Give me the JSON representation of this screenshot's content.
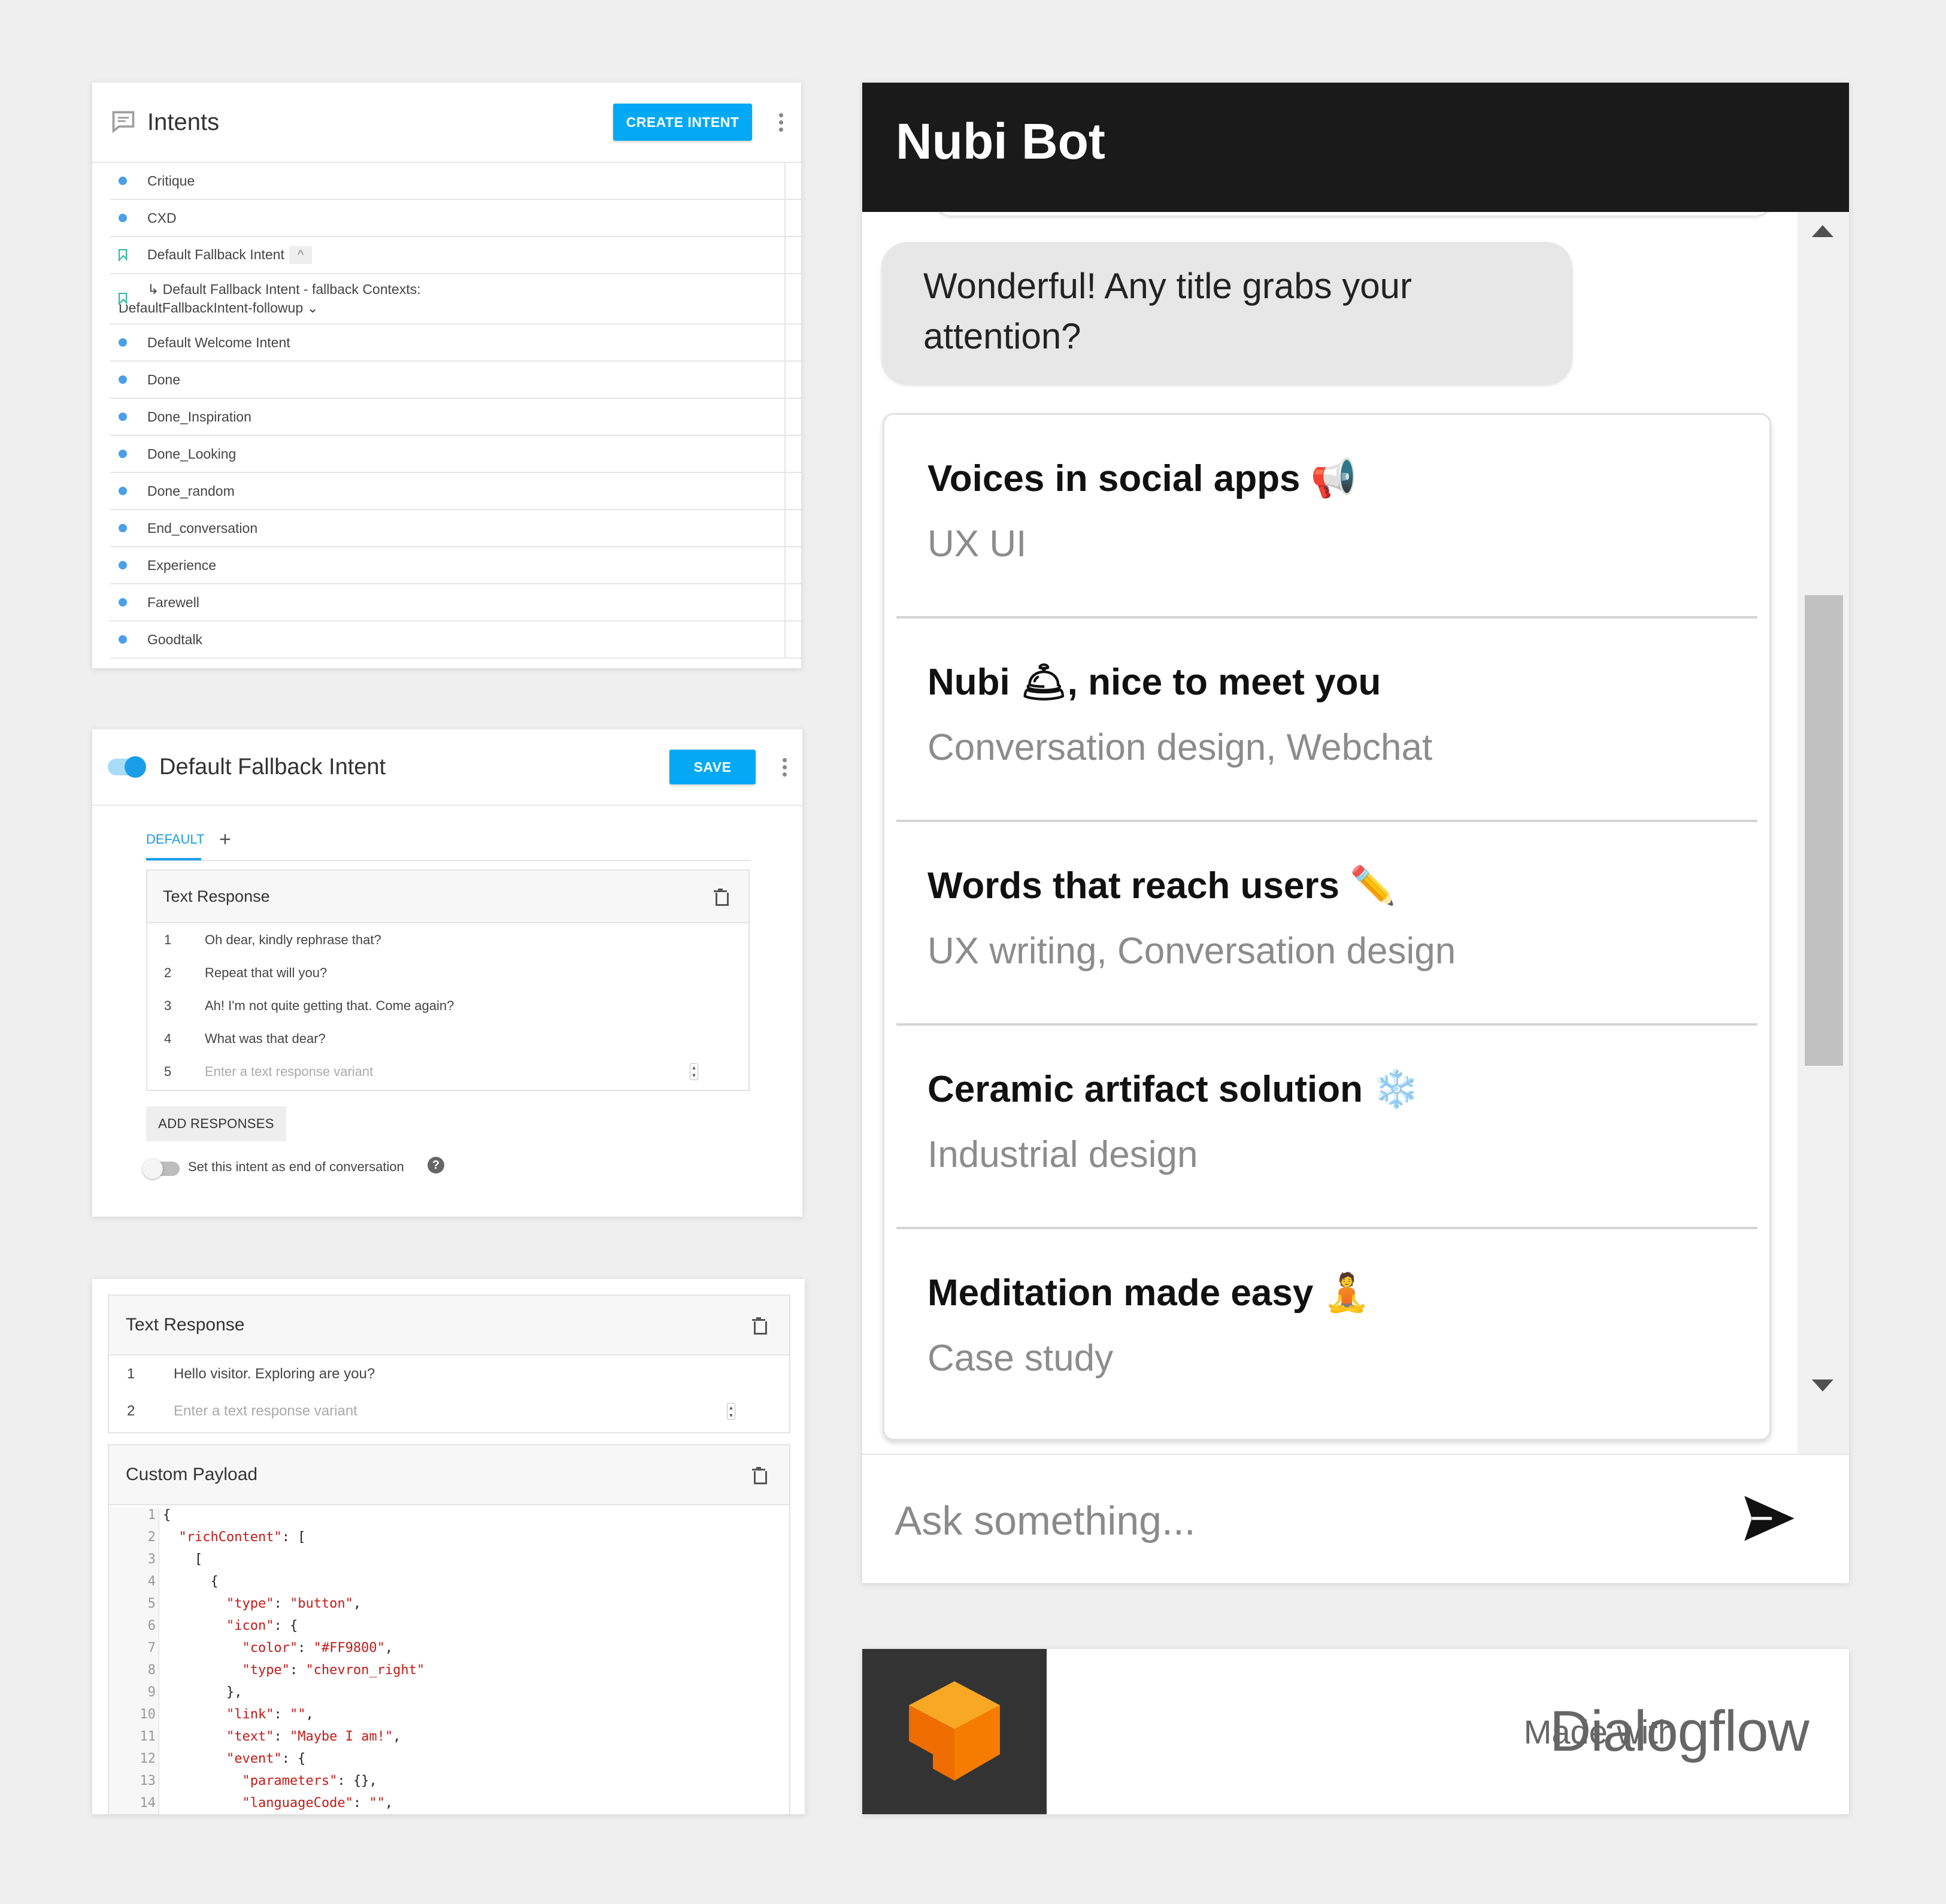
{
  "intents_panel": {
    "title": "Intents",
    "create_button": "CREATE INTENT",
    "items": [
      {
        "label": "Critique",
        "type": "dot"
      },
      {
        "label": "CXD",
        "type": "dot"
      },
      {
        "label": "Default Fallback Intent",
        "type": "bookmark",
        "chip": "^"
      },
      {
        "label": "↳  Default Fallback Intent - fallback     Contexts:",
        "label2": "DefaultFallbackIntent-followup  ⌄",
        "type": "bookmark"
      },
      {
        "label": "Default Welcome Intent",
        "type": "dot"
      },
      {
        "label": "Done",
        "type": "dot"
      },
      {
        "label": "Done_Inspiration",
        "type": "dot"
      },
      {
        "label": "Done_Looking",
        "type": "dot"
      },
      {
        "label": "Done_random",
        "type": "dot"
      },
      {
        "label": "End_conversation",
        "type": "dot"
      },
      {
        "label": "Experience",
        "type": "dot"
      },
      {
        "label": "Farewell",
        "type": "dot"
      },
      {
        "label": "Goodtalk",
        "type": "dot"
      }
    ]
  },
  "fallback_panel": {
    "title": "Default Fallback Intent",
    "save_button": "SAVE",
    "tab_default": "DEFAULT",
    "tab_add": "+",
    "card_title": "Text Response",
    "responses": [
      {
        "num": "1",
        "text": "Oh dear, kindly rephrase that?"
      },
      {
        "num": "2",
        "text": "Repeat that will you?"
      },
      {
        "num": "3",
        "text": "Ah! I'm not quite getting that. Come again?"
      },
      {
        "num": "4",
        "text": "What was that dear?"
      }
    ],
    "placeholder_num": "5",
    "placeholder": "Enter a text response variant",
    "add_responses": "ADD RESPONSES",
    "end_conversation_label": "Set this intent as end of conversation",
    "end_conversation_enabled": false
  },
  "payload_panel": {
    "text_card_title": "Text Response",
    "responses": [
      {
        "num": "1",
        "text": "Hello visitor. Exploring are you?"
      }
    ],
    "placeholder_num": "2",
    "placeholder": "Enter a text response variant",
    "payload_title": "Custom Payload",
    "code_lines": [
      {
        "n": "1",
        "code": "{"
      },
      {
        "n": "2",
        "code": "  \"richContent\": ["
      },
      {
        "n": "3",
        "code": "    ["
      },
      {
        "n": "4",
        "code": "      {"
      },
      {
        "n": "5",
        "code": "        \"type\": \"button\","
      },
      {
        "n": "6",
        "code": "        \"icon\": {"
      },
      {
        "n": "7",
        "code": "          \"color\": \"#FF9800\","
      },
      {
        "n": "8",
        "code": "          \"type\": \"chevron_right\""
      },
      {
        "n": "9",
        "code": "        },"
      },
      {
        "n": "10",
        "code": "        \"link\": \"\","
      },
      {
        "n": "11",
        "code": "        \"text\": \"Maybe I am!\","
      },
      {
        "n": "12",
        "code": "        \"event\": {"
      },
      {
        "n": "13",
        "code": "          \"parameters\": {},"
      },
      {
        "n": "14",
        "code": "          \"languageCode\": \"\","
      }
    ]
  },
  "bot": {
    "title": "Nubi Bot",
    "bubble_text": "Wonderful! Any title grabs your attention?",
    "items": [
      {
        "title": "Voices in social apps 📢",
        "subtitle": "UX UI"
      },
      {
        "title": "Nubi 🛎, nice to meet you",
        "subtitle": "Conversation design, Webchat"
      },
      {
        "title": "Words that reach users ✏️",
        "subtitle": "UX writing, Conversation design"
      },
      {
        "title": "Ceramic artifact solution ❄️",
        "subtitle": "Industrial design"
      },
      {
        "title": "Meditation made easy 🧘",
        "subtitle": "Case study"
      }
    ],
    "input_placeholder": "Ask something..."
  },
  "banner": {
    "made_with": "Made with",
    "brand": "Dialogflow"
  },
  "colors": {
    "accent_blue": "#03a9f4",
    "bot_header": "#1a1a1a",
    "dialogflow_orange": "#f08c1c",
    "logo_box": "#333333"
  }
}
